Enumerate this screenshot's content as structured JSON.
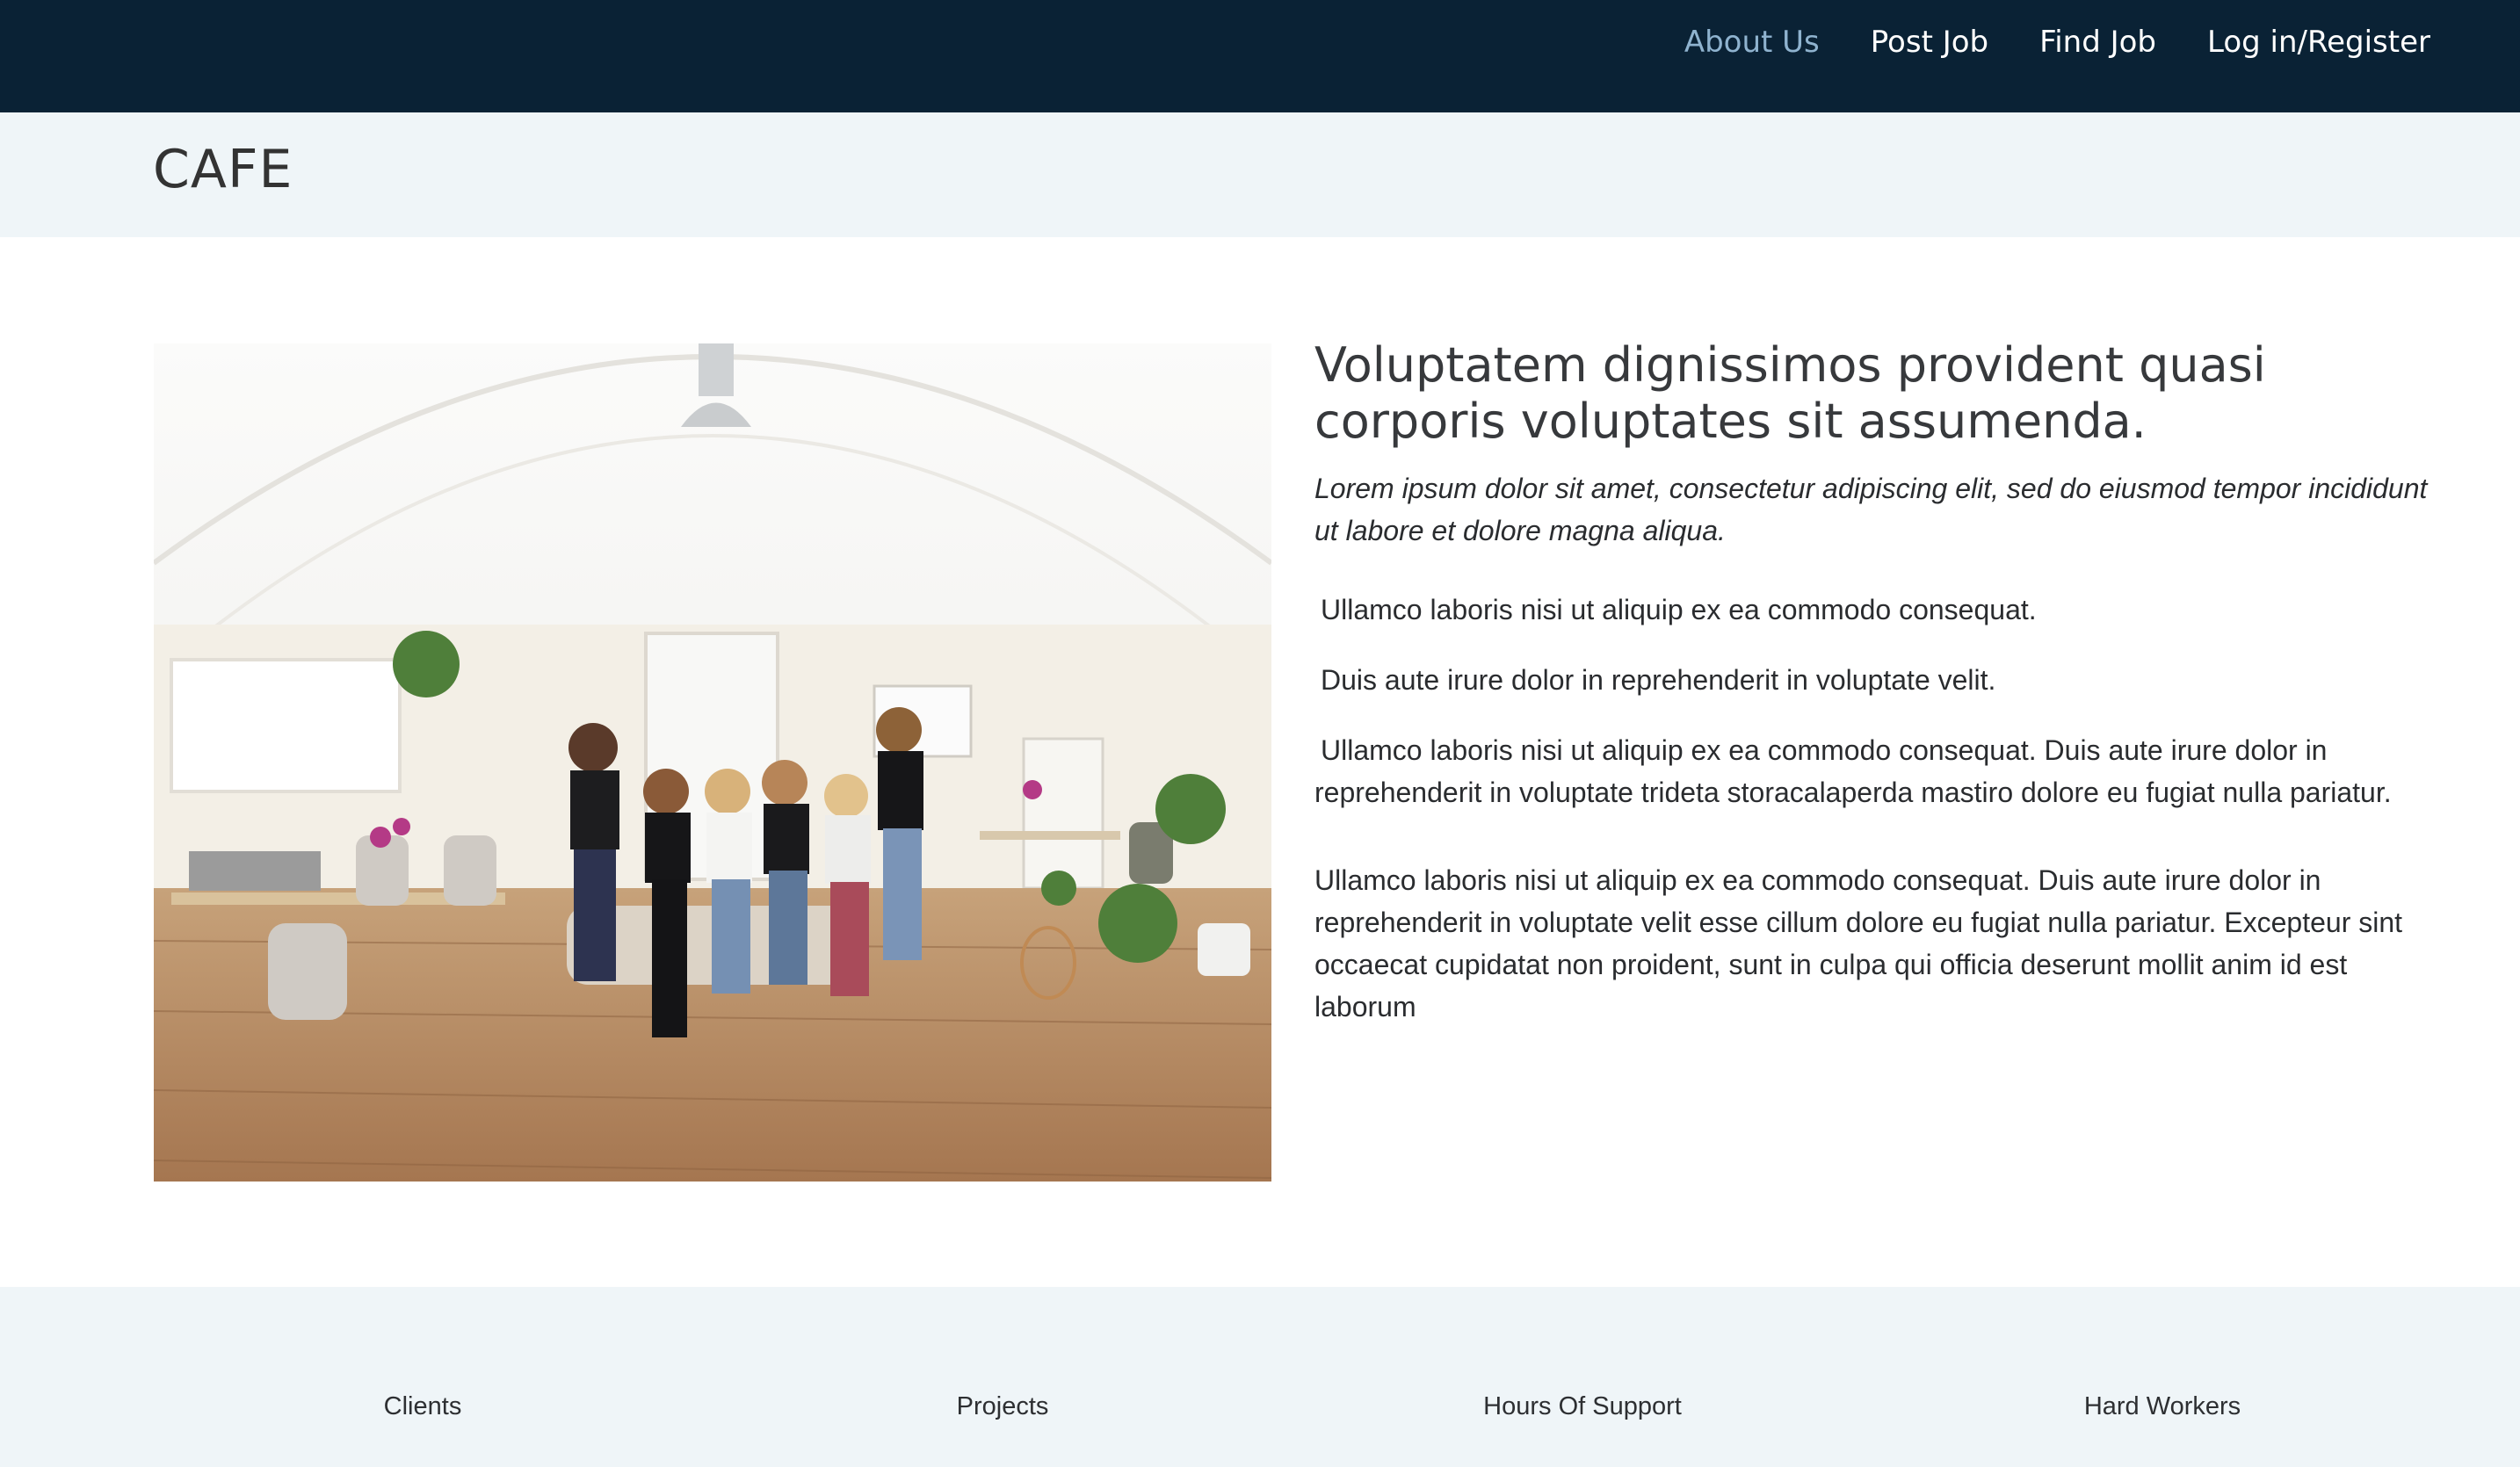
{
  "navbar": {
    "links": [
      {
        "label": "About Us",
        "active": true
      },
      {
        "label": "Post Job"
      },
      {
        "label": "Find Job"
      },
      {
        "label": "Log in/Register"
      }
    ],
    "background": "#0a2235",
    "active_color": "#8fb3cf"
  },
  "breadcrumb": {
    "title": "CAFE"
  },
  "main": {
    "image": {
      "type": "photo"
    },
    "heading": "Voluptatem dignissimos provident quasi corporis voluptates sit assumenda.",
    "lead": "Lorem ipsum dolor sit amet, consectetur adipiscing elit, sed do eiusmod tempor incididunt ut labore et dolore magna aliqua.",
    "paragraphs": [
      "Ullamco laboris nisi ut aliquip ex ea commodo consequat.",
      "Duis aute irure dolor in reprehenderit in voluptate velit.",
      "Ullamco laboris nisi ut aliquip ex ea commodo consequat. Duis aute irure dolor in reprehenderit in voluptate trideta storacalaperda mastiro dolore eu fugiat nulla pariatur.",
      "Ullamco laboris nisi ut aliquip ex ea commodo consequat. Duis aute irure dolor in reprehenderit in voluptate velit esse cillum dolore eu fugiat nulla pariatur. Excepteur sint occaecat cupidatat non proident, sunt in culpa qui officia deserunt mollit anim id est laborum"
    ]
  },
  "footer": {
    "stats": [
      {
        "label": "Clients"
      },
      {
        "label": "Projects"
      },
      {
        "label": "Hours Of Support"
      },
      {
        "label": "Hard Workers"
      }
    ],
    "background": "#eff5f8"
  }
}
